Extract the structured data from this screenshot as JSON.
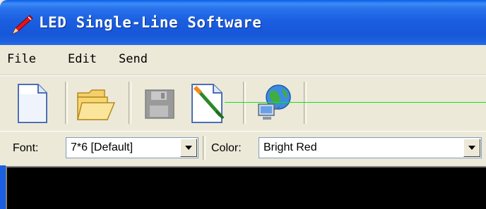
{
  "window": {
    "title": "LED Single-Line Software",
    "title_icon": "pen-icon"
  },
  "menu": {
    "items": [
      {
        "label": "File"
      },
      {
        "label": "Edit"
      },
      {
        "label": "Send"
      }
    ]
  },
  "toolbar": {
    "buttons": [
      {
        "name": "new-document-icon",
        "enabled": true
      },
      {
        "name": "open-folder-icon",
        "enabled": true
      },
      {
        "name": "save-disk-icon",
        "enabled": false
      },
      {
        "name": "edit-brush-icon",
        "enabled": true
      },
      {
        "name": "network-globe-icon",
        "enabled": true
      }
    ]
  },
  "options": {
    "font_label": "Font:",
    "font_value": "7*6 [Default]",
    "color_label": "Color:",
    "color_value": "Bright Red"
  },
  "colors": {
    "titlebar": "#1657d8",
    "chrome": "#ece9d8",
    "display": "#000000",
    "indicator_line": "#12e512"
  }
}
